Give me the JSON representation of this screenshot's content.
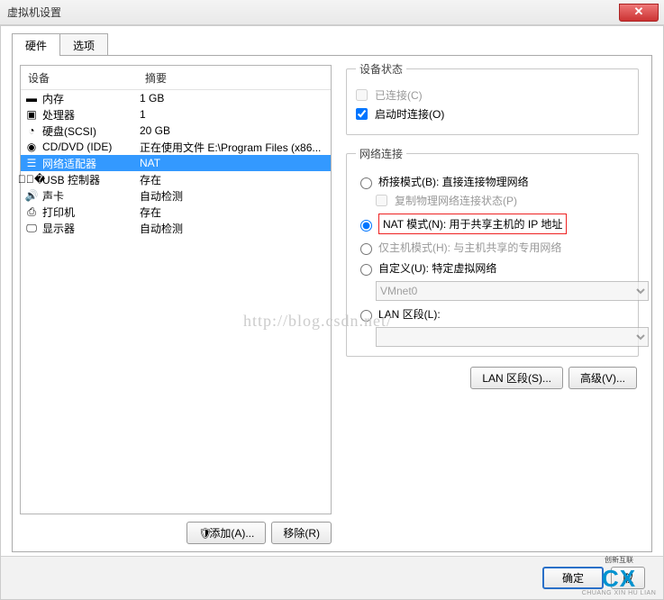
{
  "window": {
    "title": "虚拟机设置"
  },
  "tabs": {
    "hardware": "硬件",
    "options": "选项"
  },
  "columns": {
    "device": "设备",
    "summary": "摘要"
  },
  "devices": [
    {
      "name": "内存",
      "summary": "1 GB",
      "icon": "memory"
    },
    {
      "name": "处理器",
      "summary": "1",
      "icon": "cpu"
    },
    {
      "name": "硬盘(SCSI)",
      "summary": "20 GB",
      "icon": "disk"
    },
    {
      "name": "CD/DVD (IDE)",
      "summary": "正在使用文件 E:\\Program Files (x86...",
      "icon": "cd"
    },
    {
      "name": "网络适配器",
      "summary": "NAT",
      "icon": "net",
      "selected": true
    },
    {
      "name": "USB 控制器",
      "summary": "存在",
      "icon": "usb"
    },
    {
      "name": "声卡",
      "summary": "自动检测",
      "icon": "sound"
    },
    {
      "name": "打印机",
      "summary": "存在",
      "icon": "printer"
    },
    {
      "name": "显示器",
      "summary": "自动检测",
      "icon": "display"
    }
  ],
  "hw_buttons": {
    "add": "添加(A)...",
    "remove": "移除(R)"
  },
  "device_state": {
    "legend": "设备状态",
    "connected": "已连接(C)",
    "connect_at_power": "启动时连接(O)"
  },
  "network": {
    "legend": "网络连接",
    "bridge": "桥接模式(B): 直接连接物理网络",
    "replicate": "复制物理网络连接状态(P)",
    "nat": "NAT 模式(N): 用于共享主机的 IP 地址",
    "hostonly": "仅主机模式(H): 与主机共享的专用网络",
    "custom": "自定义(U): 特定虚拟网络",
    "custom_value": "VMnet0",
    "lan": "LAN 区段(L):",
    "lan_btn": "LAN 区段(S)...",
    "adv_btn": "高级(V)..."
  },
  "bottom": {
    "ok": "确定",
    "cancel": "取"
  },
  "watermark": "http://blog.csdn.net/",
  "logo": {
    "top": "创新互联",
    "big": "CX",
    "small": "CHUANG XIN HU LIAN"
  }
}
